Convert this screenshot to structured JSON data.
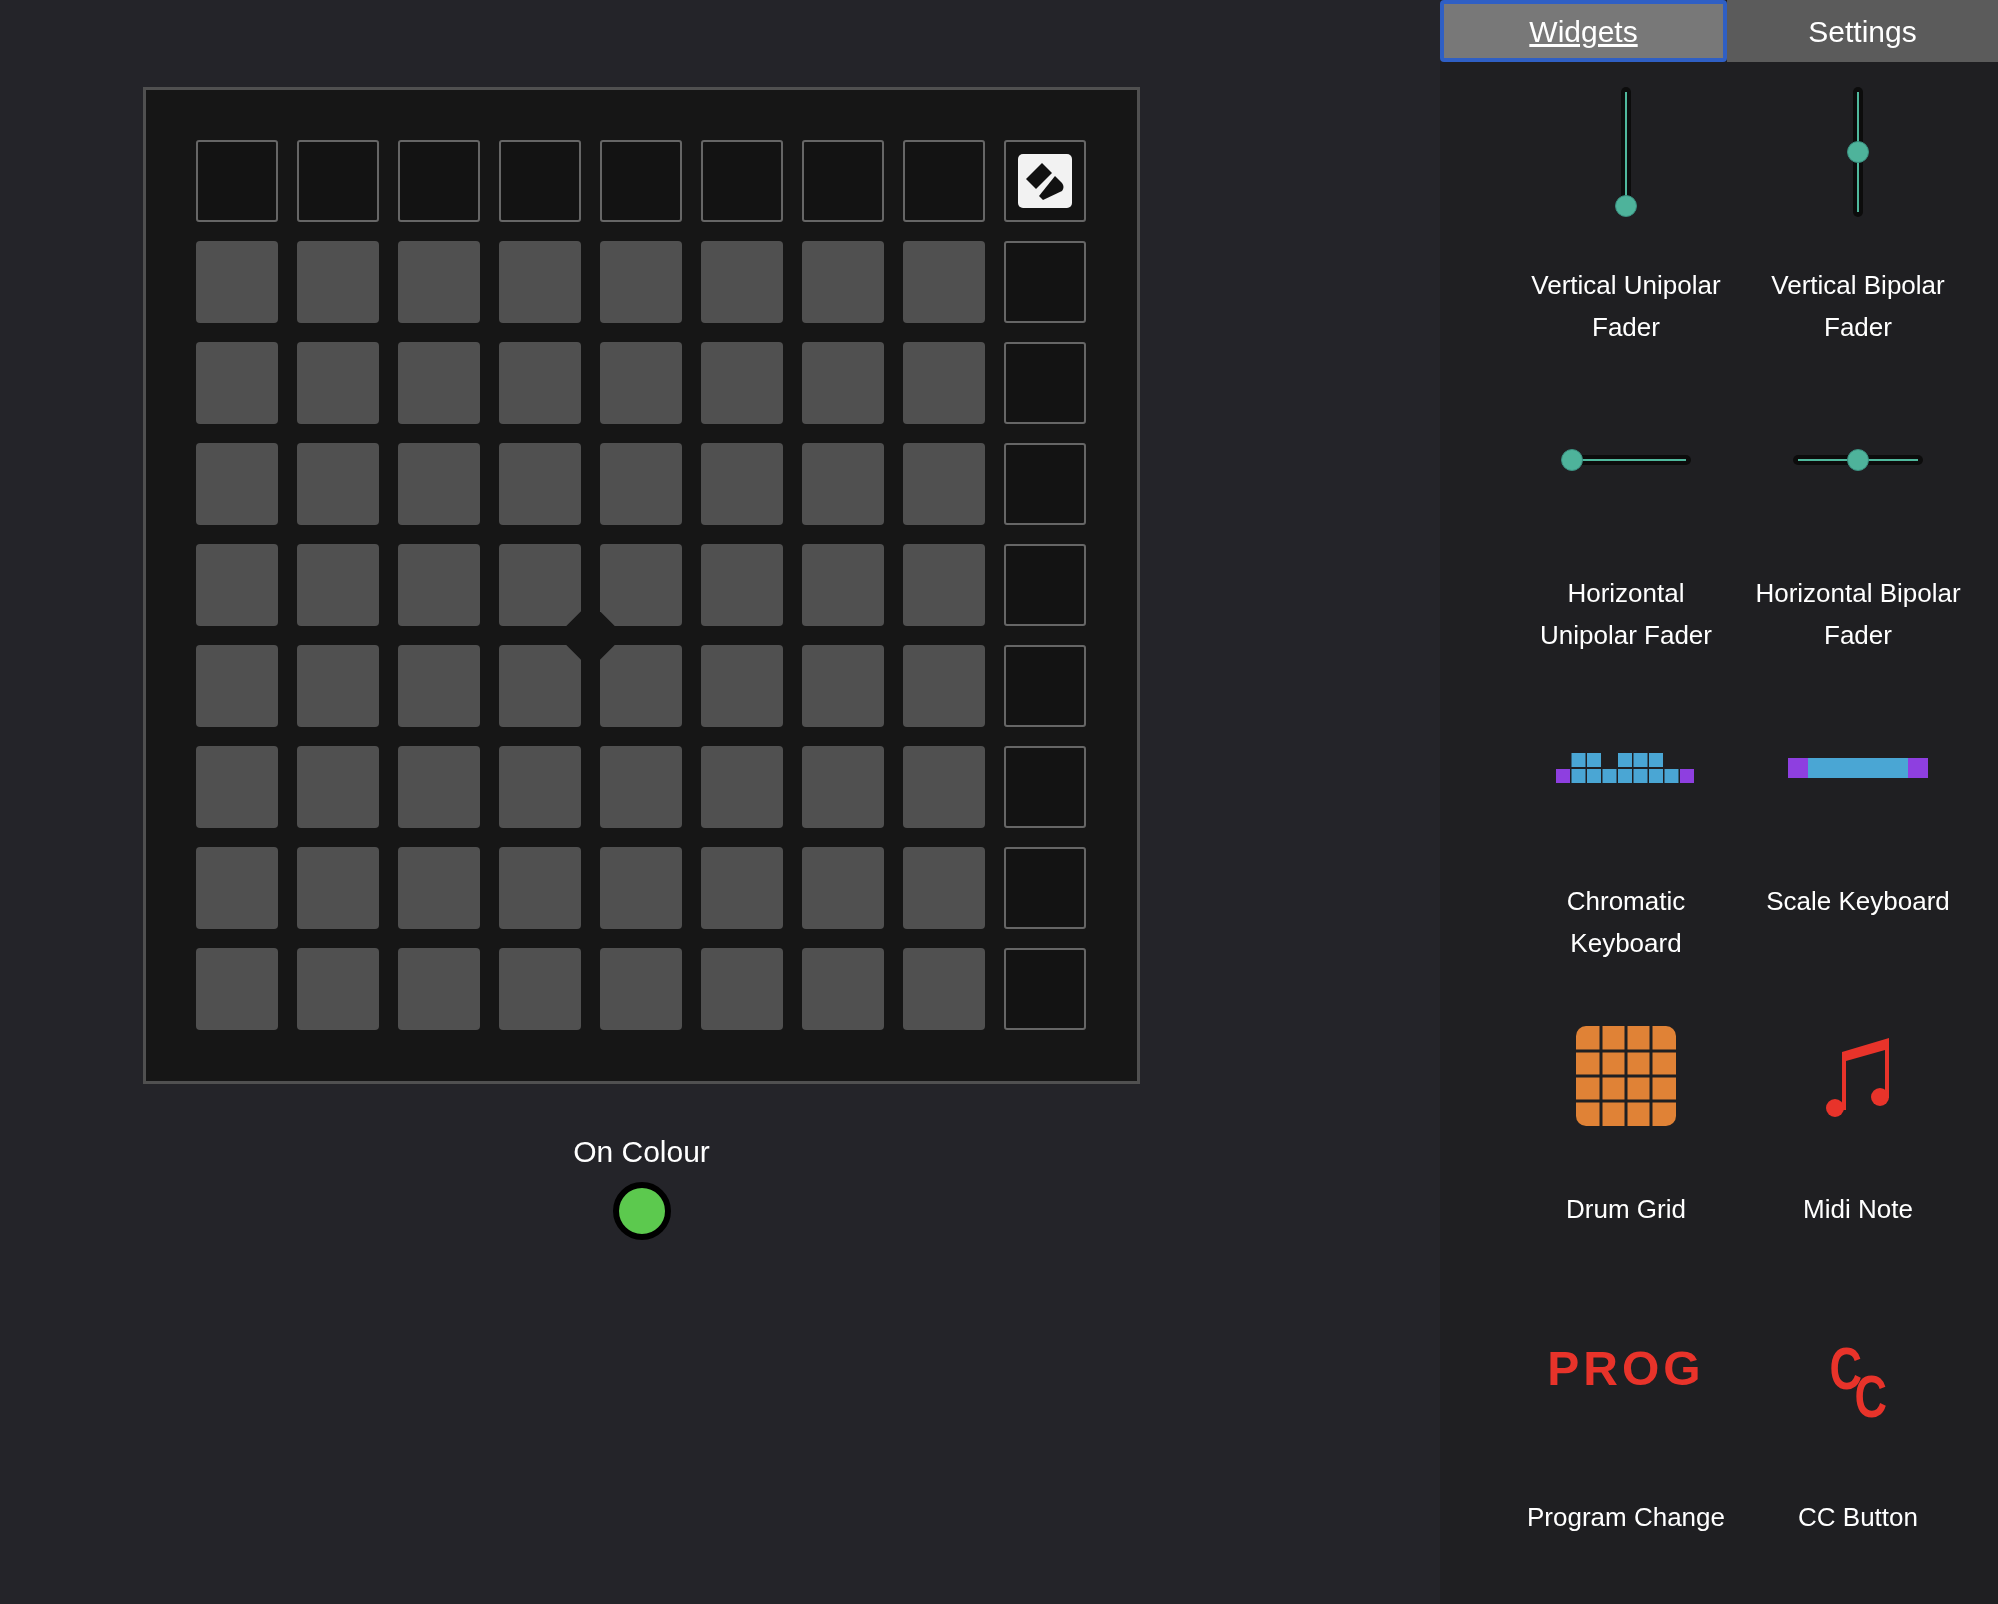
{
  "tabs": [
    {
      "label": "Widgets",
      "selected": true
    },
    {
      "label": "Settings",
      "selected": false
    }
  ],
  "on_colour": {
    "label": "On Colour",
    "color": "#5cc94e"
  },
  "widgets": [
    {
      "kind": "vertical-fader",
      "label": "Vertical Unipolar\nFader",
      "level": 0
    },
    {
      "kind": "vertical-fader",
      "label": "Vertical Bipolar\nFader",
      "level": 0.5
    },
    {
      "kind": "horizontal-fader",
      "label": "Horizontal\nUnipolar Fader",
      "level": 0
    },
    {
      "kind": "horizontal-fader",
      "label": "Horizontal Bipolar\nFader",
      "level": 0.5
    },
    {
      "kind": "chromatic-keyboard",
      "label": "Chromatic\nKeyboard"
    },
    {
      "kind": "scale-keyboard",
      "label": "Scale Keyboard"
    },
    {
      "kind": "drum-grid",
      "label": "Drum Grid"
    },
    {
      "kind": "midi-note",
      "label": "Midi Note"
    },
    {
      "kind": "prog",
      "icon_text": "PROG",
      "label": "Program Change"
    },
    {
      "kind": "cc",
      "icon_text": "CC",
      "label": "CC Button"
    }
  ]
}
